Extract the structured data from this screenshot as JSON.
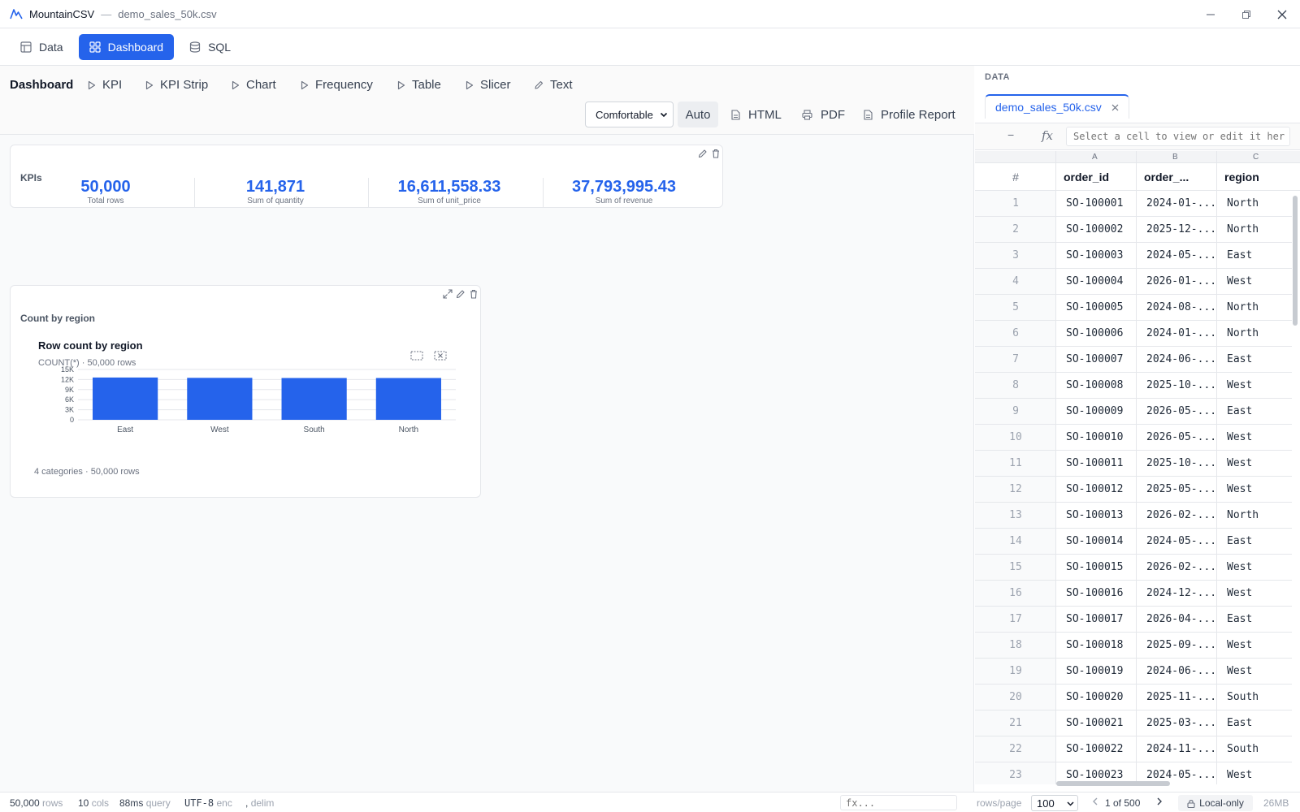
{
  "window": {
    "app_name": "MountainCSV",
    "separator": "—",
    "file_name": "demo_sales_50k.csv"
  },
  "nav": {
    "tabs": [
      {
        "label": "Data"
      },
      {
        "label": "Dashboard",
        "active": true
      },
      {
        "label": "SQL"
      }
    ]
  },
  "dashboard": {
    "title": "Dashboard",
    "add_buttons": [
      "KPI",
      "KPI Strip",
      "Chart",
      "Frequency",
      "Table",
      "Slicer",
      "Text"
    ],
    "density_select": "Comfortable",
    "auto_label": "Auto",
    "export_html": "HTML",
    "export_pdf": "PDF",
    "profile_report": "Profile Report",
    "kpi_card": {
      "title": "KPIs",
      "kpis": [
        {
          "value": "50,000",
          "label": "Total rows"
        },
        {
          "value": "141,871",
          "label": "Sum of quantity"
        },
        {
          "value": "16,611,558.33",
          "label": "Sum of unit_price"
        },
        {
          "value": "37,793,995.43",
          "label": "Sum of revenue"
        }
      ]
    },
    "chart_card": {
      "title": "Count by region",
      "chart_title": "Row count by region",
      "chart_subtitle": "COUNT(*) · 50,000 rows",
      "footer": "4 categories · 50,000 rows"
    }
  },
  "chart_data": {
    "type": "bar",
    "title": "Row count by region",
    "subtitle": "COUNT(*) · 50,000 rows",
    "categories": [
      "East",
      "West",
      "South",
      "North"
    ],
    "values": [
      12600,
      12500,
      12450,
      12450
    ],
    "y_ticks": [
      "0",
      "3K",
      "6K",
      "9K",
      "12K",
      "15K"
    ],
    "ylim": [
      0,
      15000
    ],
    "grid": true,
    "color": "#2563eb"
  },
  "data_panel": {
    "label": "DATA",
    "file_tab": "demo_sales_50k.csv",
    "formula_placeholder": "Select a cell to view or edit it her",
    "minus": "−",
    "fx": "fx",
    "col_letters": [
      "A",
      "B",
      "C"
    ],
    "headers": [
      "#",
      "order_id",
      "order_...",
      "region"
    ],
    "rows": [
      [
        "1",
        "SO-100001",
        "2024-01-...",
        "North"
      ],
      [
        "2",
        "SO-100002",
        "2025-12-...",
        "North"
      ],
      [
        "3",
        "SO-100003",
        "2024-05-...",
        "East"
      ],
      [
        "4",
        "SO-100004",
        "2026-01-...",
        "West"
      ],
      [
        "5",
        "SO-100005",
        "2024-08-...",
        "North"
      ],
      [
        "6",
        "SO-100006",
        "2024-01-...",
        "North"
      ],
      [
        "7",
        "SO-100007",
        "2024-06-...",
        "East"
      ],
      [
        "8",
        "SO-100008",
        "2025-10-...",
        "West"
      ],
      [
        "9",
        "SO-100009",
        "2026-05-...",
        "East"
      ],
      [
        "10",
        "SO-100010",
        "2026-05-...",
        "West"
      ],
      [
        "11",
        "SO-100011",
        "2025-10-...",
        "West"
      ],
      [
        "12",
        "SO-100012",
        "2025-05-...",
        "West"
      ],
      [
        "13",
        "SO-100013",
        "2026-02-...",
        "North"
      ],
      [
        "14",
        "SO-100014",
        "2024-05-...",
        "East"
      ],
      [
        "15",
        "SO-100015",
        "2026-02-...",
        "West"
      ],
      [
        "16",
        "SO-100016",
        "2024-12-...",
        "West"
      ],
      [
        "17",
        "SO-100017",
        "2026-04-...",
        "East"
      ],
      [
        "18",
        "SO-100018",
        "2025-09-...",
        "West"
      ],
      [
        "19",
        "SO-100019",
        "2024-06-...",
        "West"
      ],
      [
        "20",
        "SO-100020",
        "2025-11-...",
        "South"
      ],
      [
        "21",
        "SO-100021",
        "2025-03-...",
        "East"
      ],
      [
        "22",
        "SO-100022",
        "2024-11-...",
        "South"
      ],
      [
        "23",
        "SO-100023",
        "2024-05-...",
        "West"
      ]
    ]
  },
  "status": {
    "rows_value": "50,000",
    "rows_label": "rows",
    "cols_value": "10",
    "cols_label": "cols",
    "query_value": "88ms",
    "query_label": "query",
    "enc_value": "UTF-8",
    "enc_label": "enc",
    "delim_value": ",",
    "delim_label": "delim",
    "fx_placeholder": "fx...",
    "rows_per_page_label": "rows/page",
    "rows_per_page_value": "100",
    "page_info": "1 of 500",
    "local_only": "Local-only",
    "memory": "26MB"
  },
  "colors": {
    "accent": "#2563eb"
  }
}
